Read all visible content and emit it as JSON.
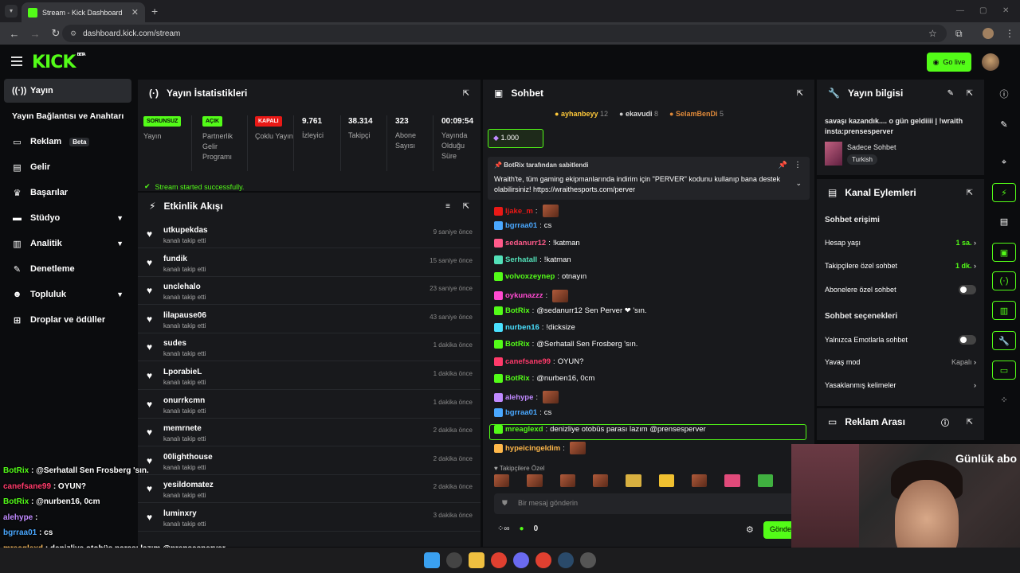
{
  "browser": {
    "tab_title": "Stream - Kick Dashboard",
    "url": "dashboard.kick.com/stream"
  },
  "header": {
    "logo": "KICK",
    "logo_beta": "BETA",
    "go_live": "Go live"
  },
  "sidebar": {
    "items": [
      {
        "label": "Yayın",
        "icon": "broadcast-icon"
      },
      {
        "label": "Yayın Bağlantısı ve Anahtarı",
        "icon": ""
      },
      {
        "label": "Reklam",
        "icon": "tv-icon",
        "badge": "Beta"
      },
      {
        "label": "Gelir",
        "icon": "chart-icon"
      },
      {
        "label": "Başarılar",
        "icon": "trophy-icon"
      },
      {
        "label": "Stüdyo",
        "icon": "studio-icon"
      },
      {
        "label": "Analitik",
        "icon": "analytics-icon"
      },
      {
        "label": "Denetleme",
        "icon": "wrench-icon"
      },
      {
        "label": "Topluluk",
        "icon": "community-icon"
      },
      {
        "label": "Droplar ve ödüller",
        "icon": "gift-icon"
      }
    ]
  },
  "stats_panel": {
    "title": "Yayın İstatistikleri",
    "stats": [
      {
        "badge": "SORUNSUZ",
        "label": "Yayın"
      },
      {
        "badge": "AÇIK",
        "label": "Partnerlik Gelir Programı"
      },
      {
        "badge": "KAPALI",
        "label": "Çoklu Yayın"
      },
      {
        "value": "9.761",
        "label": "İzleyici"
      },
      {
        "value": "38.314",
        "label": "Takipçi"
      },
      {
        "value": "323",
        "label": "Abone Sayısı"
      },
      {
        "value": "00:09:54",
        "label": "Yayında Olduğu Süre"
      }
    ],
    "success": "Stream started successfully."
  },
  "events_panel": {
    "title": "Etkinlik Akışı",
    "action": "kanalı takip etti",
    "events": [
      {
        "name": "utkupekdas",
        "time": "9 saniye önce"
      },
      {
        "name": "fundik",
        "time": "15 saniye önce"
      },
      {
        "name": "unclehalo",
        "time": "23 saniye önce"
      },
      {
        "name": "lilapause06",
        "time": "43 saniye önce"
      },
      {
        "name": "sudes",
        "time": "1 dakika önce"
      },
      {
        "name": "LporabieL",
        "time": "1 dakika önce"
      },
      {
        "name": "onurrkcmn",
        "time": "1 dakika önce"
      },
      {
        "name": "memrnete",
        "time": "2 dakika önce"
      },
      {
        "name": "00lighthouse",
        "time": "2 dakika önce"
      },
      {
        "name": "yesildomatez",
        "time": "2 dakika önce"
      },
      {
        "name": "luminxry",
        "time": "3 dakika önce"
      }
    ]
  },
  "chat": {
    "title": "Sohbet",
    "gifters": [
      {
        "name": "ayhanbeyy",
        "count": "12"
      },
      {
        "name": "ekavudi",
        "count": "8"
      },
      {
        "name": "SelamBenDi",
        "count": "5"
      }
    ],
    "goal": "1.000",
    "pinned_by": "BotRix tarafından sabitlendi",
    "pinned_text": "Wraith'te, tüm gaming ekipmanlarında indirim için \"PERVER\" kodunu kullanıp bana destek olabilirsiniz! https://wraithesports.com/perver",
    "messages": [
      {
        "user": "ljake_m",
        "text": "",
        "color": "#e91916"
      },
      {
        "user": "bgrraa01",
        "text": "cs",
        "color": "#4aa8ff"
      },
      {
        "user": "sedanurr12",
        "text": "!katman",
        "color": "#ff5a8a"
      },
      {
        "user": "Serhatall",
        "text": "!katman",
        "color": "#53e0b8"
      },
      {
        "user": "volvoxzeynep",
        "text": "otnayın",
        "color": "#53fc18"
      },
      {
        "user": "oykunazzz",
        "text": "",
        "color": "#ff4ad0"
      },
      {
        "user": "BotRix",
        "text": "@sedanurr12 Sen Perver ❤ 'sın.",
        "color": "#53fc18"
      },
      {
        "user": "nurben16",
        "text": "!dicksize",
        "color": "#4ae0ff"
      },
      {
        "user": "BotRix",
        "text": "@Serhatall Sen Frosberg 'sın.",
        "color": "#53fc18"
      },
      {
        "user": "canefsane99",
        "text": "OYUN?",
        "color": "#ff3a6a"
      },
      {
        "user": "BotRix",
        "text": "@nurben16, 0cm",
        "color": "#53fc18"
      },
      {
        "user": "alehype",
        "text": "",
        "color": "#c08aff"
      },
      {
        "user": "bgrraa01",
        "text": "cs",
        "color": "#4aa8ff"
      },
      {
        "user": "mreaglexd",
        "text": "denizliye otobüs parası lazım @prensesperver",
        "color": "#53fc18"
      },
      {
        "user": "hypeicingeldim",
        "text": "",
        "color": "#ffb84a"
      }
    ],
    "followers_only": "Takipçilere Özel",
    "placeholder": "Bir mesaj gönderin",
    "count": "0",
    "send": "Gönder"
  },
  "stream_info": {
    "title": "Yayın bilgisi",
    "stream_title": "savaşı kazandık.... o gün geldiiii | !wraith insta:prensesperver",
    "category": "Sadece Sohbet",
    "tag": "Turkish"
  },
  "channel_actions": {
    "title": "Kanal Eylemleri",
    "access_title": "Sohbet erişimi",
    "rows": [
      {
        "label": "Hesap yaşı",
        "value": "1 sa."
      },
      {
        "label": "Takipçilere özel sohbet",
        "value": "1 dk."
      },
      {
        "label": "Abonelere özel sohbet",
        "value": ""
      }
    ],
    "options_title": "Sohbet seçenekleri",
    "opt_rows": [
      {
        "label": "Yalnızca Emotlarla sohbet",
        "value": ""
      },
      {
        "label": "Yavaş mod",
        "value": "Kapalı"
      },
      {
        "label": "Yasaklanmış kelimeler",
        "value": ""
      }
    ]
  },
  "ad_break": {
    "title": "Reklam Arası"
  },
  "overlay_chat": [
    {
      "user": "BotRix",
      "text": ": @Serhatall Sen Frosberg 'sın."
    },
    {
      "user": "canefsane99",
      "text": ": OYUN?"
    },
    {
      "user": "BotRix",
      "text": ": @nurben16, 0cm"
    },
    {
      "user": "alehype",
      "text": ":"
    },
    {
      "user": "bgrraa01",
      "text": ": cs"
    },
    {
      "user": "mreaglexd",
      "text": ": denizliye otobüs parası lazım @prensesperver"
    },
    {
      "user": "hypeicingeldim",
      "text": ":"
    }
  ],
  "webcam_text": "Günlük abo"
}
